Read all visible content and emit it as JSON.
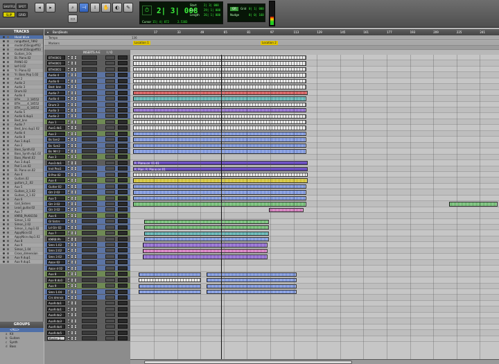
{
  "toolbar": {
    "zoom_buttons": [
      "SHUFFLE",
      "SPOT",
      "SLIP",
      "GRID"
    ],
    "counter": {
      "main": "2| 3| 008",
      "start_label": "Start",
      "end_label": "End",
      "length_label": "Length",
      "start": "2| 3| 008",
      "end": "29| 1| 000",
      "length": "26| 1| 000",
      "cursor_label": "Cursor",
      "cursor": "15| 4| 872",
      "cursor_pos": "2.5383"
    },
    "grid": {
      "grid_label": "Grid",
      "nudge_label": "Nudge",
      "grid_value": "0| 1| 000",
      "nudge_value": "0| 0| 160",
      "mode": "GR"
    }
  },
  "left_panel": {
    "tracks_title": "TRACKS",
    "groups_title": "GROUPS",
    "tracks": [
      "Hvad blive",
      "runguttoid_7892",
      "mvdm35SkipJeff02",
      "mvdm35SkipJeff03",
      "Guitars_3.0c",
      "Bi. Piano.02",
      "PIANO.02",
      "kef 0.02",
      "Yr. Piano.02",
      "Yr. Bass Pop 1.02",
      "mel 2",
      "Audio 2",
      "Audio 3",
      "Drum.02",
      "Audio 4",
      "BTH_____2_18552",
      "BTH_____4_18552",
      "BTH_____6_18552",
      "Audio 5",
      "Audio 6.dup1",
      "Best_bnn",
      "Audio 7",
      "Best_bnc.dup1 02",
      "Audio 4",
      "Audio 8",
      "Aux 1.dup1",
      "Aux 2",
      "Bass_Synth.02",
      "Bass_Synth.dp1.02",
      "Bass_Morell.02",
      "Aux 3.dup1",
      "Pad 1.on.02",
      "Bi. Piano on.02",
      "Aux 4",
      "Guitars.02",
      "guitars_2_.02",
      "Aux 5",
      "Guitars_3_1.02",
      "Guitars_3_1.02",
      "Aux 6",
      "Gall_Sisters",
      "Lead_guitar.02",
      "Aux 7",
      "KMRB_Ph/66158",
      "Simon_1.02",
      "Simon_2.02",
      "Simon_3_dup1.02",
      "AppyNice.02",
      "AppyNice.dup1.02",
      "Aux 8",
      "Aux 9",
      "Simon_1.04",
      "Cross_dimension",
      "Aux 9.dup1",
      "Aux 9.dup1"
    ],
    "groups": [
      {
        "letter": "",
        "name": "<ALL>"
      },
      {
        "letter": "a",
        "name": "Kit"
      },
      {
        "letter": "b",
        "name": "Guitars"
      },
      {
        "letter": "c",
        "name": "Synth"
      },
      {
        "letter": "d",
        "name": "Bass"
      }
    ]
  },
  "edit": {
    "header_title": "Bars|Beats",
    "ruler_labels": [
      "17",
      "33",
      "49",
      "65",
      "81",
      "97",
      "113",
      "129",
      "145",
      "161",
      "177",
      "193",
      "209",
      "225",
      "241"
    ],
    "rows": {
      "tempo": "Tempo",
      "markers": "Markers",
      "meter": "136"
    },
    "markers": [
      {
        "name": "Location 1"
      },
      {
        "name": "Location 2"
      }
    ],
    "columns": {
      "inserts": "INSERTS A-E",
      "io": "I / O"
    },
    "tracks": [
      {
        "name": "BTH0001",
        "color": "dark"
      },
      {
        "name": "BTH0001",
        "color": "dark"
      },
      {
        "name": "BTH0001",
        "color": "dark"
      },
      {
        "name": "Audio 4",
        "color": "blue"
      },
      {
        "name": "Audio 6",
        "color": "blue"
      },
      {
        "name": "Best_bnn",
        "color": "blue"
      },
      {
        "name": "Audio 7",
        "color": "blue"
      },
      {
        "name": "Audio 4",
        "color": "blue"
      },
      {
        "name": "Drum 3",
        "color": "blue"
      },
      {
        "name": "Audio 3",
        "color": "blue"
      },
      {
        "name": "Audio 2",
        "color": "blue"
      },
      {
        "name": "Aux 1",
        "color": "green"
      },
      {
        "name": "Aux1.dp1",
        "color": "dark"
      },
      {
        "name": "Aux 2",
        "color": "green"
      },
      {
        "name": "Bs Syn2",
        "color": "blue"
      },
      {
        "name": "Bs_Syn2",
        "color": "blue"
      },
      {
        "name": "Bs_Mrl 2",
        "color": "blue"
      },
      {
        "name": "Aux 3",
        "color": "green"
      },
      {
        "name": "Aux3.dp1",
        "color": "dark"
      },
      {
        "name": "Inst Pno1",
        "color": "blue"
      },
      {
        "name": "B Pno 02",
        "color": "blue"
      },
      {
        "name": "Aux 4",
        "color": "green"
      },
      {
        "name": "Guitar 02",
        "color": "blue"
      },
      {
        "name": "Gtr 2 02",
        "color": "blue"
      },
      {
        "name": "Aux 5",
        "color": "green"
      },
      {
        "name": "Gtr 3 02",
        "color": "blue"
      },
      {
        "name": "Gtr 3 02",
        "color": "blue"
      },
      {
        "name": "Aux 6",
        "color": "green"
      },
      {
        "name": "GI Sistrs",
        "color": "blue"
      },
      {
        "name": "Ld Gtr 02",
        "color": "blue"
      },
      {
        "name": "Aux 7",
        "color": "green"
      },
      {
        "name": "KMRB Ph",
        "color": "dark"
      },
      {
        "name": "Smn 1.02",
        "color": "blue"
      },
      {
        "name": "Smn 2.02",
        "color": "blue"
      },
      {
        "name": "Smn 3 02",
        "color": "blue"
      },
      {
        "name": "Appy 02",
        "color": "blue"
      },
      {
        "name": "Appy d 02",
        "color": "blue"
      },
      {
        "name": "Aux 8",
        "color": "green"
      },
      {
        "name": "Aux 8.dp1",
        "color": "dark"
      },
      {
        "name": "Aux 9",
        "color": "green"
      },
      {
        "name": "Smn 1.04",
        "color": "blue"
      },
      {
        "name": "Crs dmnsn",
        "color": "blue"
      },
      {
        "name": "Aux9.dp1",
        "color": "dark"
      },
      {
        "name": "Aux9.dp1",
        "color": "dark"
      },
      {
        "name": "Aux9.dp2",
        "color": "dark"
      },
      {
        "name": "Aux9.dp3",
        "color": "dark"
      },
      {
        "name": "Aux9.dp4",
        "color": "dark"
      },
      {
        "name": "Aux9.dp5",
        "color": "dark"
      },
      {
        "name": "Master 1",
        "color": "dark"
      }
    ],
    "clip_names": {
      "piano1": "R. Piano.on_01-01",
      "piano2": "R. Pian. R. Piano.on.01"
    }
  }
}
